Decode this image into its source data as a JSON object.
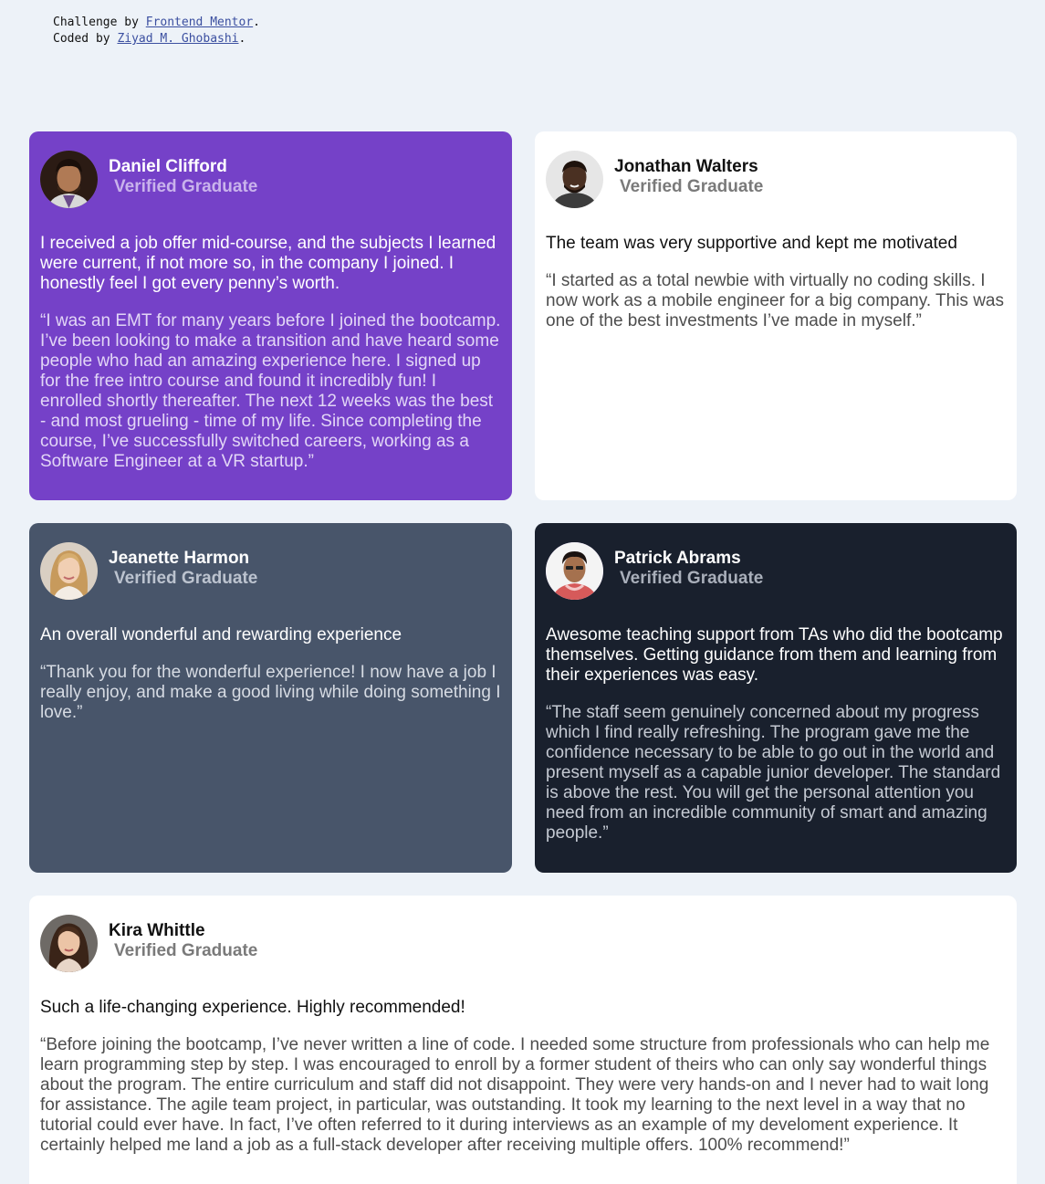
{
  "attribution": {
    "line1_prefix": "Challenge by ",
    "line1_link": "Frontend Mentor",
    "line1_suffix": ".",
    "line2_prefix": "Coded by ",
    "line2_link": "Ziyad M. Ghobashi",
    "line2_suffix": "."
  },
  "testimonials": [
    {
      "name": "Daniel Clifford",
      "badge": "Verified Graduate",
      "headline": "I received a job offer mid-course, and the subjects I learned were current, if not more so, in the company I joined. I honestly feel I got every penny’s worth.",
      "quote": "“I was an EMT for many years before I joined the bootcamp. I’ve been looking to make a transition and have heard some people who had an amazing experience here. I signed up for the free intro course and found it incredibly fun! I enrolled shortly thereafter. The next 12 weeks was the best - and most grueling - time of my life. Since completing the course, I’ve successfully switched careers, working as a Software Engineer at a VR startup.”",
      "background": "#7541c8"
    },
    {
      "name": "Jonathan Walters",
      "badge": "Verified Graduate",
      "headline": "The team was very supportive and kept me motivated",
      "quote": "“I started as a total newbie with virtually no coding skills. I now work as a mobile engineer for a big company. This was one of the best investments I’ve made in myself.”",
      "background": "#ffffff"
    },
    {
      "name": "Jeanette Harmon",
      "badge": "Verified Graduate",
      "headline": "An overall wonderful and rewarding experience",
      "quote": "“Thank you for the wonderful experience! I now have a job I really enjoy, and make a good living while doing something I love.”",
      "background": "#48556a"
    },
    {
      "name": "Patrick Abrams",
      "badge": "Verified Graduate",
      "headline": "Awesome teaching support from TAs who did the bootcamp themselves. Getting guidance from them and learning from their experiences was easy.",
      "quote": "“The staff seem genuinely concerned about my progress which I find really refreshing. The program gave me the confidence necessary to be able to go out in the world and present myself as a capable junior developer. The standard is above the rest. You will get the personal attention you need from an incredible community of smart and amazing people.”",
      "background": "#19202d"
    },
    {
      "name": "Kira Whittle",
      "badge": "Verified Graduate",
      "headline": "Such a life-changing experience. Highly recommended!",
      "quote": "“Before joining the bootcamp, I’ve never written a line of code. I needed some structure from professionals who can help me learn programming step by step. I was encouraged to enroll by a former student of theirs who can only say wonderful things about the program. The entire curriculum and staff did not disappoint. They were very hands-on and I never had to wait long for assistance. The agile team project, in particular, was outstanding. It took my learning to the next level in a way that no tutorial could ever have. In fact, I’ve often referred to it during interviews as an example of my develoment experience. It certainly helped me land a job as a full-stack developer after receiving multiple offers. 100% recommend!”",
      "background": "#ffffff"
    }
  ]
}
